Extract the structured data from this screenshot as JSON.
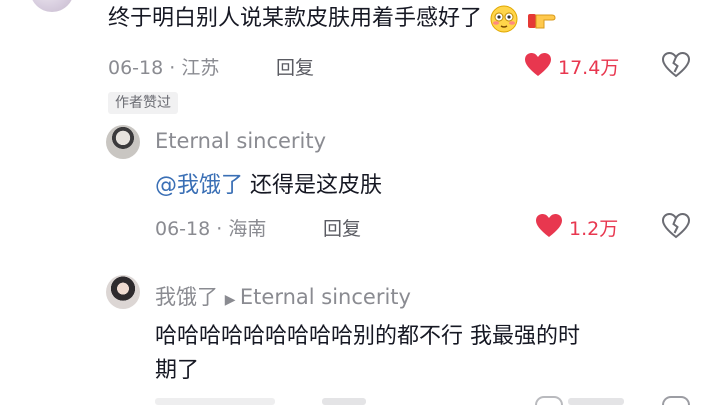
{
  "comments": [
    {
      "text": "终于明白别人说某款皮肤用着手感好了",
      "date": "06-18",
      "location": "江苏",
      "reply_label": "回复",
      "likes": "17.4万",
      "badge": "作者赞过",
      "icons": [
        "flushed-emoji-icon",
        "pointing-hand-icon"
      ]
    },
    {
      "user": "Eternal sincerity",
      "mention": "@我饿了",
      "text": "还得是这皮肤",
      "date": "06-18",
      "location": "海南",
      "reply_label": "回复",
      "likes": "1.2万"
    },
    {
      "user": "我饿了",
      "reply_to": "Eternal sincerity",
      "text_line1": "哈哈哈哈哈哈哈哈哈别的都不行 我最强的时",
      "text_line2": "期了"
    }
  ],
  "colors": {
    "like_red": "#e8374f",
    "meta_gray": "#8a8b91",
    "mention_blue": "#3a6fb5"
  }
}
